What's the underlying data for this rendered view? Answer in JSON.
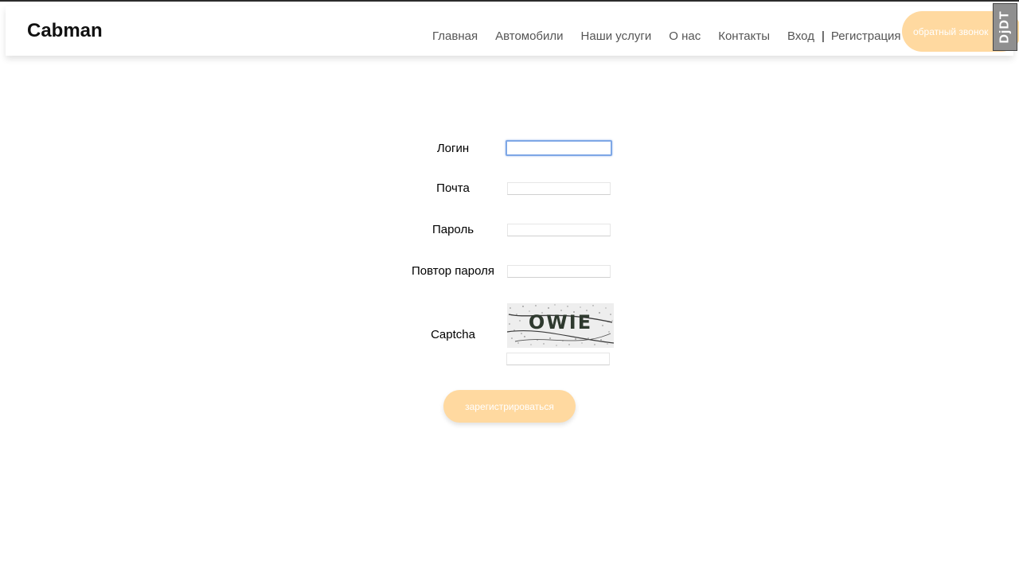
{
  "brand": "Cabman",
  "nav": {
    "items": [
      "Главная",
      "Автомобили",
      "Наши услуги",
      "О нас",
      "Контакты"
    ],
    "login": "Вход",
    "separator": "|",
    "register": "Регистрация",
    "callback_button": "обратный звонок"
  },
  "debug_toolbar": "DjDT",
  "form": {
    "login_label": "Логин",
    "login_value": "",
    "email_label": "Почта",
    "password_label": "Пароль",
    "password_repeat_label": "Повтор пароля",
    "captcha_label": "Captcha",
    "captcha_text": "OWIE",
    "submit_label": "зарегистрироваться"
  },
  "colors": {
    "accent": "#ffd9a0",
    "focus": "#7ea7e6"
  }
}
